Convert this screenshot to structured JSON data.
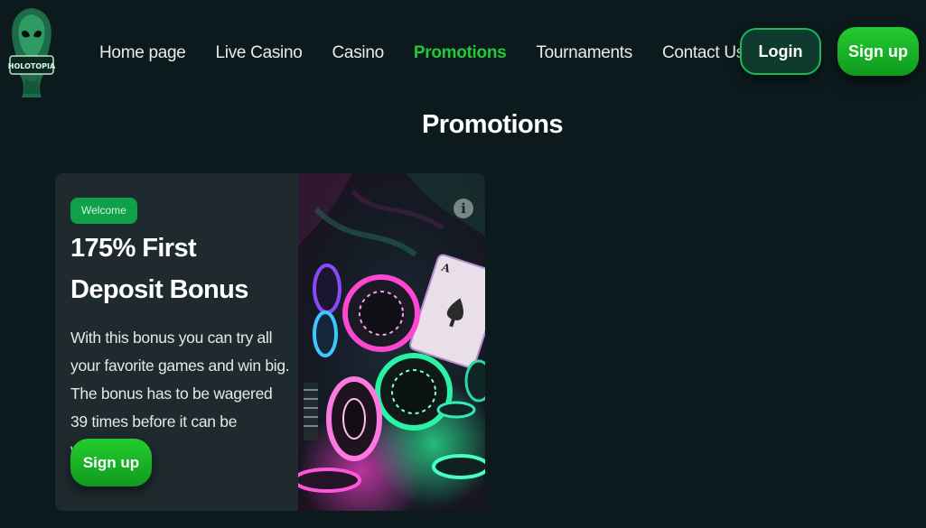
{
  "header": {
    "logo_icon": "alien-hooded-mascot-logo",
    "logo_text": "HOLOTOPIA",
    "nav": [
      {
        "label": "Home page",
        "active": false
      },
      {
        "label": "Live Casino",
        "active": false
      },
      {
        "label": "Casino",
        "active": false
      },
      {
        "label": "Promotions",
        "active": true
      },
      {
        "label": "Tournaments",
        "active": false
      },
      {
        "label": "Contact Us",
        "active": false
      }
    ],
    "login_label": "Login",
    "signup_label": "Sign up"
  },
  "main": {
    "title": "Promotions",
    "promo_card": {
      "badge": "Welcome",
      "title": "175% First Deposit Bonus",
      "description": "With this bonus you can try all your favorite games and win big. The bonus has to be wagered 39 times before it can be withdrawn.",
      "cta_label": "Sign up",
      "info_icon": "info-icon",
      "image": "neon casino chips and playing cards"
    }
  },
  "colors": {
    "background": "#0c1a1e",
    "card": "#1e2a2d",
    "accent_green": "#22c935",
    "badge_green": "#0ea14a",
    "login_border": "#21b65a"
  }
}
